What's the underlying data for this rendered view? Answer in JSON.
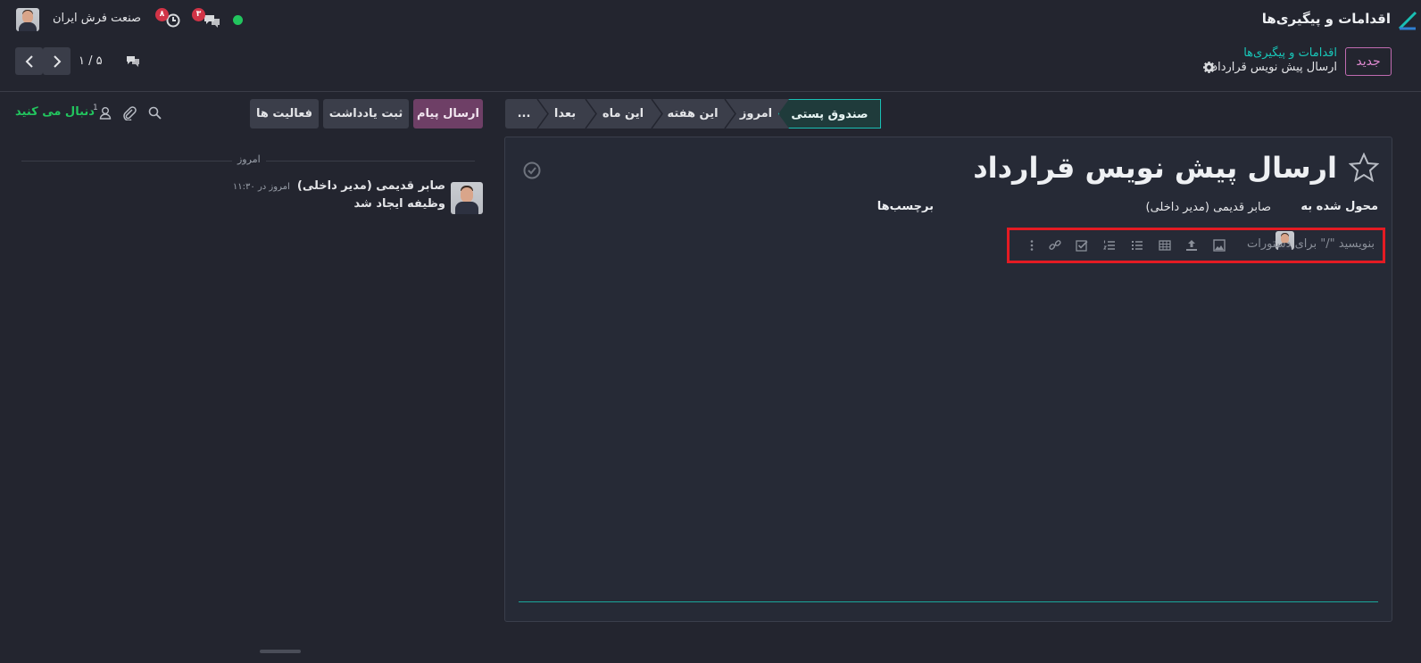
{
  "top_bar": {
    "app_title": "اقدامات و پیگیری‌ها",
    "company": "صنعت فرش ایران",
    "messages_count": "۳",
    "activities_count": "۸",
    "status_color": "#22c55e"
  },
  "control_panel": {
    "new_button": "جدید",
    "breadcrumb_parent": "اقدامات و پیگیری‌ها",
    "breadcrumb_current": "ارسال پیش نویس قرارداد",
    "pager_value": "۵ / ۱"
  },
  "chatter": {
    "send_message": "ارسال پیام",
    "log_note": "ثبت یادداشت",
    "activities": "فعالیت ها",
    "follow": "دنبال می کنید",
    "followers_count": "1",
    "date_separator": "امروز",
    "message": {
      "author": "صابر قدیمی (مدیر داخلی)",
      "time": "امروز در ۱۱:۳۰",
      "body": "وظیفه ایجاد شد"
    }
  },
  "stages": {
    "items": [
      "صندوق پستی",
      "امروز",
      "این هفته",
      "این ماه",
      "بعدا",
      "..."
    ],
    "active": "صندوق پستی"
  },
  "record": {
    "title": "ارسال پیش نویس قرارداد",
    "assigned_label": "محول شده به",
    "assigned_value": "صابر قدیمی (مدیر داخلی)",
    "tags_label": "برچسب‌ها",
    "editor_placeholder": "بنویسید \"/\" برای دستورات"
  },
  "colors": {
    "accent_teal": "#19c0b4",
    "primary_button": "#6e3f66",
    "highlight_box": "#e41b23",
    "background": "#23252f"
  }
}
